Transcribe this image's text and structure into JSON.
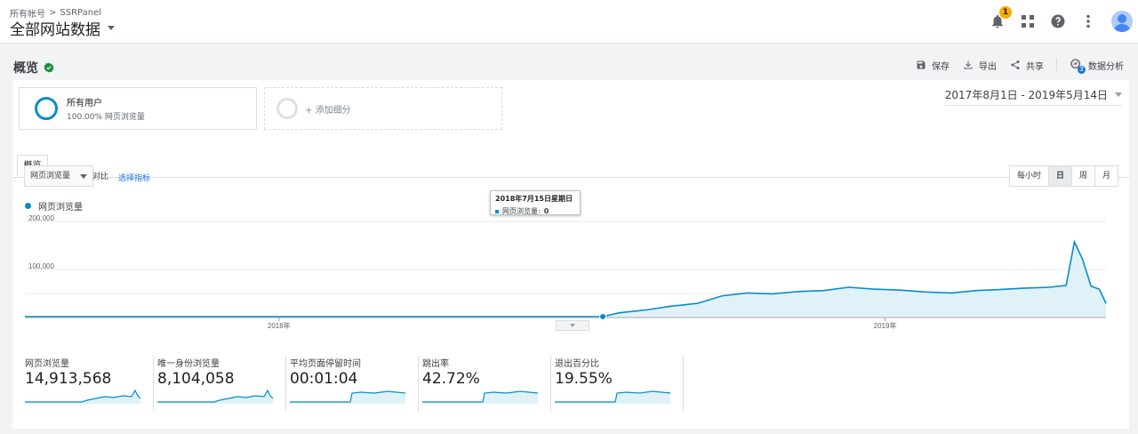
{
  "header": {
    "breadcrumb": {
      "account": "所有帐号",
      "separator": ">",
      "property": "SSRPanel"
    },
    "view_title": "全部网站数据",
    "notification_count": "1"
  },
  "report": {
    "title": "概览",
    "actions": {
      "save": "保存",
      "export": "导出",
      "share": "共享",
      "insights": "数据分析"
    },
    "insights_badge": "3"
  },
  "segments": {
    "active": {
      "name": "所有用户",
      "detail": "100.00% 网页浏览量"
    },
    "add_label": "+ 添加细分"
  },
  "date_range": "2017年8月1日 - 2019年5月14日",
  "tabs": [
    {
      "label": "概览"
    }
  ],
  "controls": {
    "metric_select": "网页浏览量",
    "vs": "对比",
    "choose_metric": "选择指标",
    "granularity": [
      {
        "label": "每小时",
        "active": false
      },
      {
        "label": "日",
        "active": true
      },
      {
        "label": "周",
        "active": false
      },
      {
        "label": "月",
        "active": false
      }
    ]
  },
  "legend": {
    "series": "网页浏览量"
  },
  "tooltip": {
    "title": "2018年7月15日星期日",
    "metric": "网页浏览量:",
    "value": "0"
  },
  "chart_data": {
    "type": "area",
    "x_labels": [
      "2018年",
      "2019年"
    ],
    "y_ticks": [
      "200,000",
      "100,000"
    ],
    "ylim": [
      0,
      200000
    ],
    "grid": true,
    "series": [
      {
        "name": "网页浏览量",
        "color": "#058dc7",
        "points": [
          [
            "2017-08-01",
            0
          ],
          [
            "2018-07-15",
            0
          ],
          [
            "2018-07-25",
            8000
          ],
          [
            "2018-08-10",
            14000
          ],
          [
            "2018-08-25",
            22000
          ],
          [
            "2018-09-10",
            28000
          ],
          [
            "2018-09-25",
            44000
          ],
          [
            "2018-10-10",
            50000
          ],
          [
            "2018-10-25",
            48000
          ],
          [
            "2018-11-10",
            53000
          ],
          [
            "2018-11-25",
            55000
          ],
          [
            "2018-12-10",
            62000
          ],
          [
            "2018-12-25",
            58000
          ],
          [
            "2019-01-10",
            56000
          ],
          [
            "2019-01-25",
            52000
          ],
          [
            "2019-02-10",
            50000
          ],
          [
            "2019-02-25",
            55000
          ],
          [
            "2019-03-10",
            57000
          ],
          [
            "2019-03-25",
            60000
          ],
          [
            "2019-04-10",
            62000
          ],
          [
            "2019-04-20",
            66000
          ],
          [
            "2019-04-25",
            158000
          ],
          [
            "2019-04-30",
            120000
          ],
          [
            "2019-05-05",
            64000
          ],
          [
            "2019-05-10",
            58000
          ],
          [
            "2019-05-14",
            28000
          ]
        ]
      }
    ]
  },
  "kpis": [
    {
      "label": "网页浏览量",
      "value": "14,913,568",
      "shape": "spike"
    },
    {
      "label": "唯一身份浏览量",
      "value": "8,104,058",
      "shape": "spike"
    },
    {
      "label": "平均页面停留时间",
      "value": "00:01:04",
      "shape": "step"
    },
    {
      "label": "跳出率",
      "value": "42.72%",
      "shape": "step"
    },
    {
      "label": "退出百分比",
      "value": "19.55%",
      "shape": "step"
    }
  ]
}
